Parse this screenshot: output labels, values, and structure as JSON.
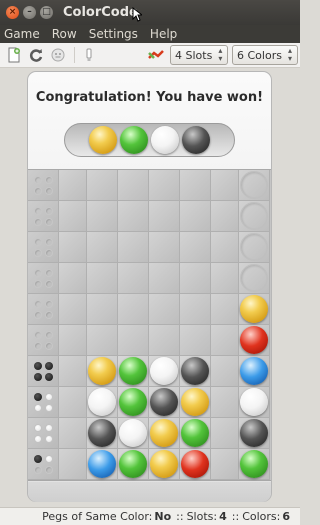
{
  "window": {
    "title": "ColorCode"
  },
  "menu": [
    "Game",
    "Row",
    "Settings",
    "Help"
  ],
  "toolbar": {
    "slots_label": "4 Slots",
    "colors_label": "6 Colors"
  },
  "board": {
    "message": "Congratulation! You have won!",
    "solution": [
      "yellow",
      "green",
      "white",
      "black"
    ],
    "rows": [
      {
        "guess": [
          "",
          "",
          "",
          ""
        ],
        "pegs": [
          "",
          "",
          "",
          ""
        ],
        "swatch": ""
      },
      {
        "guess": [
          "",
          "",
          "",
          ""
        ],
        "pegs": [
          "",
          "",
          "",
          ""
        ],
        "swatch": ""
      },
      {
        "guess": [
          "",
          "",
          "",
          ""
        ],
        "pegs": [
          "",
          "",
          "",
          ""
        ],
        "swatch": ""
      },
      {
        "guess": [
          "",
          "",
          "",
          ""
        ],
        "pegs": [
          "",
          "",
          "",
          ""
        ],
        "swatch": ""
      },
      {
        "guess": [
          "",
          "",
          "",
          ""
        ],
        "pegs": [
          "",
          "",
          "",
          ""
        ],
        "swatch": "yellow"
      },
      {
        "guess": [
          "",
          "",
          "",
          ""
        ],
        "pegs": [
          "",
          "",
          "",
          ""
        ],
        "swatch": "red"
      },
      {
        "guess": [
          "yellow",
          "green",
          "white",
          "black"
        ],
        "pegs": [
          "black",
          "black",
          "black",
          "black"
        ],
        "swatch": "blue"
      },
      {
        "guess": [
          "white",
          "green",
          "black",
          "yellow"
        ],
        "pegs": [
          "black",
          "white",
          "white",
          "white"
        ],
        "swatch": "white"
      },
      {
        "guess": [
          "black",
          "white",
          "yellow",
          "green"
        ],
        "pegs": [
          "white",
          "white",
          "white",
          "white"
        ],
        "swatch": "black"
      },
      {
        "guess": [
          "blue",
          "green",
          "yellow",
          "red"
        ],
        "pegs": [
          "black",
          "white",
          "",
          ""
        ],
        "swatch": "green"
      }
    ]
  },
  "status": {
    "same_color_label": "Pegs of Same Color:",
    "same_color_value": "No",
    "sep1": "::",
    "slots_label": "Slots:",
    "slots_value": "4",
    "sep2": "::",
    "colors_label": "Colors:",
    "colors_value": "6"
  }
}
